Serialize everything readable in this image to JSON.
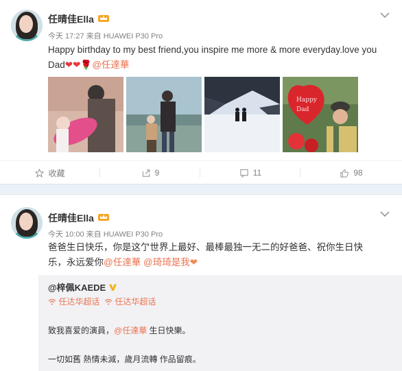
{
  "post1": {
    "author": "任晴佳Ella",
    "time": "今天 17:27",
    "source_prefix": "来自",
    "source": "HUAWEI P30 Pro",
    "text_line1": "Happy birthday to my best friend,you inspire me more & more everyday.love you",
    "text_line2": "Dad",
    "emoji_hearts": "❤❤",
    "emoji_rose": "🌹",
    "mention": "@任達華",
    "photos": [
      "child-with-umbrella",
      "father-and-child",
      "couple-in-snow",
      "man-with-balloon"
    ],
    "actions": {
      "favorite_label": "收藏",
      "repost_count": "9",
      "comment_count": "11",
      "like_count": "98"
    }
  },
  "post2": {
    "author": "任晴佳Ella",
    "time": "今天 10:00",
    "source_prefix": "来自",
    "source": "HUAWEI P30 Pro",
    "text_line1": "爸爸生日快乐，你是这亇世界上最好、最棒最独一无二的好爸爸、祝你生日快",
    "text_line2_prefix": "乐，永远爱你",
    "mention1": "@任達華",
    "mention2": "@琦琦是我",
    "end_heart": "❤",
    "repost": {
      "author": "@梓佩KAEDE",
      "tag1": "任达华超话",
      "tag2": "任达华超话",
      "line1_prefix": "致我喜爱的演員，",
      "line1_mention": "@任達華",
      "line1_suffix": " 生日快樂。",
      "line2": "一切如舊 熱情未減，歲月流轉 作品留痕。"
    }
  },
  "colors": {
    "mention": "#eb7350",
    "meta": "#808080",
    "divider": "#eaf2f8"
  }
}
